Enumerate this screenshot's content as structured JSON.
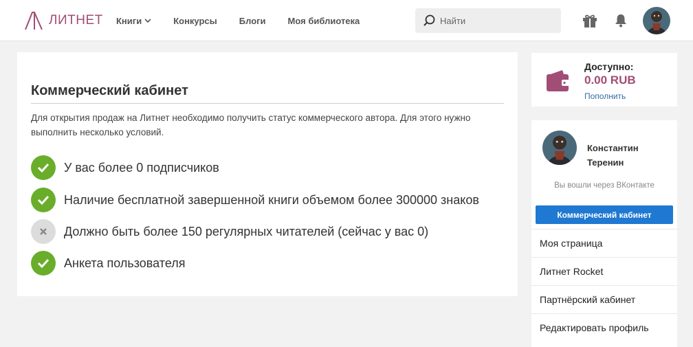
{
  "header": {
    "logo_text": "ЛИТНЕТ",
    "nav": [
      {
        "label": "Книги",
        "has_dropdown": true
      },
      {
        "label": "Конкурсы"
      },
      {
        "label": "Блоги"
      },
      {
        "label": "Моя библиотека"
      }
    ],
    "search_placeholder": "Найти",
    "brand_color": "#a14d75"
  },
  "main": {
    "title": "Коммерческий кабинет",
    "description": "Для открытия продаж на Литнет необходимо получить статус коммерческого автора. Для этого нужно выполнить несколько условий.",
    "conditions": [
      {
        "text": "У вас более 0 подписчиков",
        "status": "done"
      },
      {
        "text": "Наличие бесплатной завершенной книги объемом более 300000 знаков",
        "status": "done"
      },
      {
        "text": "Должно быть более 150 регулярных читателей (сейчас у вас 0)",
        "status": "not-done"
      },
      {
        "text": "Анкета пользователя",
        "status": "done"
      }
    ],
    "status_colors": {
      "done": "#6aad2a",
      "not-done": "#dcdcdc"
    }
  },
  "wallet": {
    "label": "Доступно:",
    "amount": "0.00 RUB",
    "topup_link": "Пополнить"
  },
  "profile": {
    "name": "Константин Теренин",
    "login_note": "Вы вошли через ВКонтакте",
    "commerce_button": "Коммерческий кабинет",
    "menu": [
      "Моя страница",
      "Литнет Rocket",
      "Партнёрский кабинет",
      "Редактировать профиль"
    ]
  }
}
